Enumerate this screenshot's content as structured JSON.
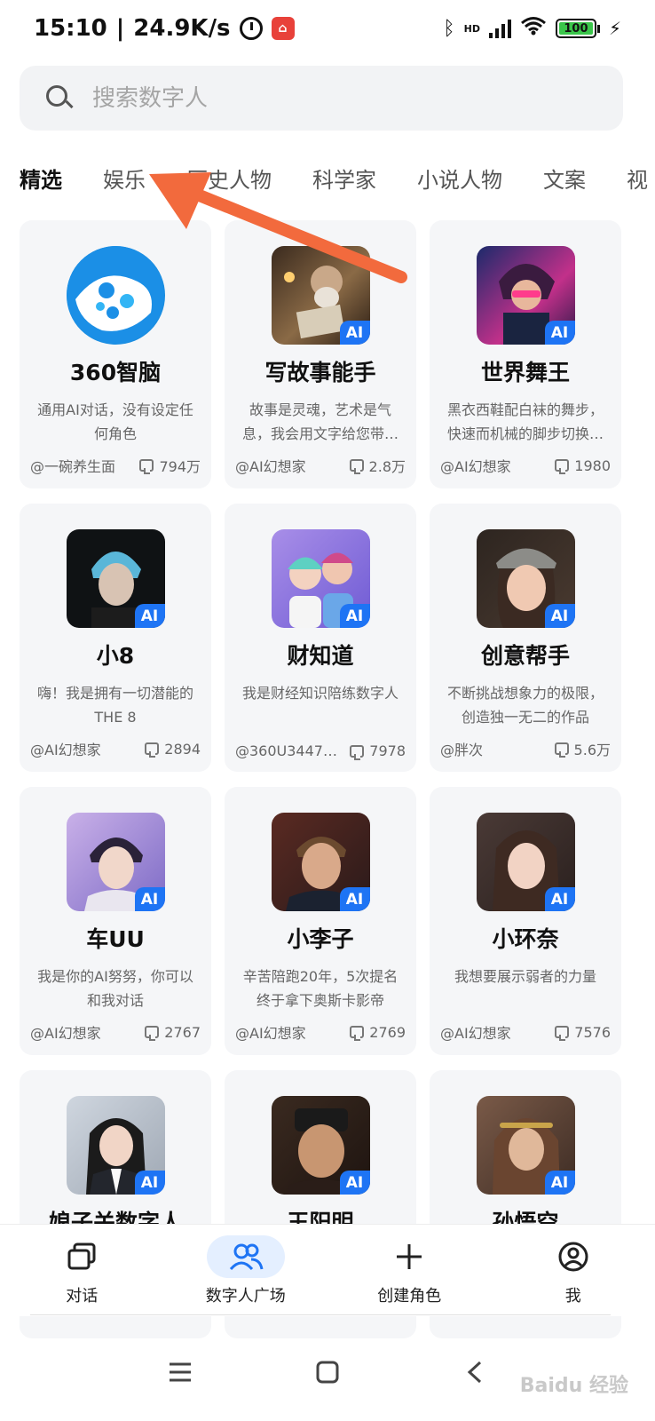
{
  "status_bar": {
    "time": "15:10",
    "network_speed": "24.9K/s",
    "app_badge_glyph": "⌂",
    "hd_label": "HD",
    "battery_level": "100",
    "icons": [
      "alarm-icon",
      "app-notification-icon",
      "bluetooth-icon",
      "signal-icon",
      "wifi-icon",
      "battery-icon",
      "charging-icon"
    ]
  },
  "search": {
    "placeholder": "搜索数字人"
  },
  "tabs": [
    {
      "label": "精选",
      "active": true
    },
    {
      "label": "娱乐",
      "active": false
    },
    {
      "label": "历史人物",
      "active": false
    },
    {
      "label": "科学家",
      "active": false
    },
    {
      "label": "小说人物",
      "active": false
    },
    {
      "label": "文案",
      "active": false
    },
    {
      "label": "视",
      "active": false
    }
  ],
  "cards": [
    {
      "name": "360智脑",
      "desc": "通用AI对话，没有设定任何角色",
      "author": "@一碗养生面",
      "count": "794万",
      "ai_badge": false
    },
    {
      "name": "写故事能手",
      "desc": "故事是灵魂，艺术是气息，我会用文字给您带…",
      "author": "@AI幻想家",
      "count": "2.8万",
      "ai_badge": true
    },
    {
      "name": "世界舞王",
      "desc": "黑衣西鞋配白袜的舞步，快速而机械的脚步切换…",
      "author": "@AI幻想家",
      "count": "1980",
      "ai_badge": true
    },
    {
      "name": "小8",
      "desc": "嗨！我是拥有一切潜能的THE 8",
      "author": "@AI幻想家",
      "count": "2894",
      "ai_badge": true
    },
    {
      "name": "财知道",
      "desc": "我是财经知识陪练数字人",
      "author": "@360U3447…",
      "count": "7978",
      "ai_badge": true
    },
    {
      "name": "创意帮手",
      "desc": "不断挑战想象力的极限，创造独一无二的作品",
      "author": "@胖次",
      "count": "5.6万",
      "ai_badge": true
    },
    {
      "name": "车UU",
      "desc": "我是你的AI努努，你可以和我对话",
      "author": "@AI幻想家",
      "count": "2767",
      "ai_badge": true
    },
    {
      "name": "小李子",
      "desc": "辛苦陪跑20年，5次提名终于拿下奥斯卡影帝",
      "author": "@AI幻想家",
      "count": "2769",
      "ai_badge": true
    },
    {
      "name": "小环奈",
      "desc": "我想要展示弱者的力量",
      "author": "@AI幻想家",
      "count": "7576",
      "ai_badge": true
    },
    {
      "name": "娘子关数字人",
      "desc": "",
      "author": "",
      "count": "",
      "ai_badge": true
    },
    {
      "name": "王阳明",
      "desc": "",
      "author": "",
      "count": "",
      "ai_badge": true
    },
    {
      "name": "孙悟空",
      "desc": "",
      "author": "",
      "count": "",
      "ai_badge": true
    }
  ],
  "ai_badge_label": "AI",
  "bottom_nav": [
    {
      "label": "对话",
      "icon": "chat-stack-icon",
      "active": false
    },
    {
      "label": "数字人广场",
      "icon": "people-icon",
      "active": true
    },
    {
      "label": "创建角色",
      "icon": "plus-icon",
      "active": false
    },
    {
      "label": "我",
      "icon": "profile-icon",
      "active": false
    }
  ],
  "watermark": "Baidu 经验",
  "colors": {
    "accent": "#1e74f4",
    "card_bg": "#f5f6f8",
    "arrow": "#f26a3d",
    "nav_active_bg": "#e4efff"
  }
}
